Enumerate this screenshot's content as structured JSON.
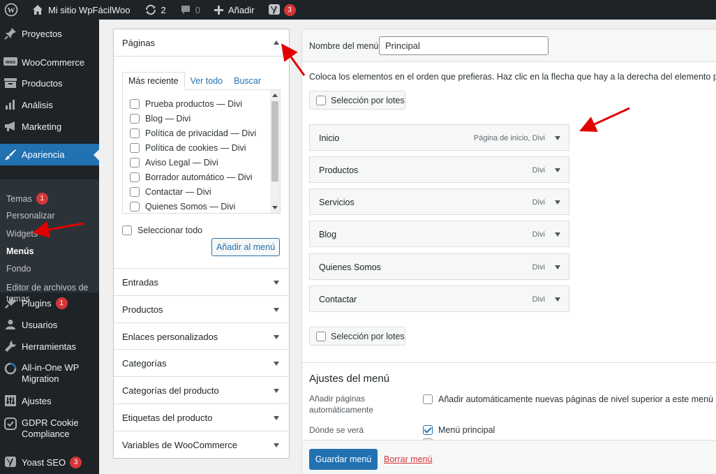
{
  "colors": {
    "adminbar_bg": "#1d2327",
    "accent": "#2271b1",
    "badge": "#d63638",
    "annotation_arrow": "#e00000"
  },
  "adminbar": {
    "wp_logo_icon": "wordpress-icon",
    "home_icon": "home-icon",
    "site_name": "Mi sitio WpFácilWoo",
    "updates_icon": "refresh-icon",
    "updates_count": "2",
    "comments_icon": "comment-icon",
    "comments_count": "0",
    "new_icon": "plus-icon",
    "new_label": "Añadir",
    "yoast_icon": "yoast-icon",
    "yoast_badge": "3"
  },
  "sidebar": {
    "items": [
      {
        "label": "Proyectos",
        "icon": "pin-icon"
      },
      {
        "label": "WooCommerce",
        "icon": "woo-icon"
      },
      {
        "label": "Productos",
        "icon": "archive-icon"
      },
      {
        "label": "Análisis",
        "icon": "chart-bars-icon"
      },
      {
        "label": "Marketing",
        "icon": "megaphone-icon"
      },
      {
        "label": "Apariencia",
        "icon": "brush-icon"
      },
      {
        "label": "Plugins",
        "icon": "plug-icon",
        "badge": "1"
      },
      {
        "label": "Usuarios",
        "icon": "user-icon"
      },
      {
        "label": "Herramientas",
        "icon": "wrench-icon"
      },
      {
        "label": "All-in-One WP Migration",
        "icon": "migration-icon"
      },
      {
        "label": "Ajustes",
        "icon": "sliders-icon"
      },
      {
        "label": "GDPR Cookie Compliance",
        "icon": "check-shield-icon"
      },
      {
        "label": "Yoast SEO",
        "icon": "yoast-icon",
        "badge": "3"
      }
    ],
    "submenu": [
      {
        "label": "Temas",
        "badge": "1"
      },
      {
        "label": "Personalizar"
      },
      {
        "label": "Widgets"
      },
      {
        "label": "Menús"
      },
      {
        "label": "Fondo"
      },
      {
        "label": "Editor de archivos de temas"
      }
    ]
  },
  "left_panel": {
    "title": "Páginas",
    "tabs": [
      "Más reciente",
      "Ver todo",
      "Buscar"
    ],
    "pages": [
      {
        "name": "Prueba productos",
        "builder": "Divi"
      },
      {
        "name": "Blog",
        "builder": "Divi"
      },
      {
        "name": "Política de privacidad",
        "builder": "Divi"
      },
      {
        "name": "Política de cookies",
        "builder": "Divi"
      },
      {
        "name": "Aviso Legal",
        "builder": "Divi"
      },
      {
        "name": "Borrador automático",
        "builder": "Divi"
      },
      {
        "name": "Contactar",
        "builder": "Divi"
      },
      {
        "name": "Quienes Somos",
        "builder": "Divi"
      }
    ],
    "separator": "—",
    "select_all": "Seleccionar todo",
    "add_button": "Añadir al menú",
    "accordions": [
      "Entradas",
      "Productos",
      "Enlaces personalizados",
      "Categorías",
      "Categorías del producto",
      "Etiquetas del producto",
      "Variables de WooCommerce"
    ]
  },
  "right_panel": {
    "name_label": "Nombre del menú",
    "name_value": "Principal",
    "instructions": "Coloca los elementos en el orden que prefieras. Haz clic en la flecha que hay a la derecha del elemento para most",
    "batch_label": "Selección por lotes",
    "menu_items": [
      {
        "title": "Inicio",
        "type": "Página de inicio, Divi"
      },
      {
        "title": "Productos",
        "type": "Divi"
      },
      {
        "title": "Servicios",
        "type": "Divi"
      },
      {
        "title": "Blog",
        "type": "Divi"
      },
      {
        "title": "Quienes Somos",
        "type": "Divi"
      },
      {
        "title": "Contactar",
        "type": "Divi"
      }
    ],
    "settings_title": "Ajustes del menú",
    "auto_add_label": "Añadir páginas automáticamente",
    "auto_add_option": "Añadir automáticamente nuevas páginas de nivel superior a este menú",
    "location_label": "Dónde se verá",
    "location_option": "Menú principal",
    "save_button": "Guardar menú",
    "delete_link": "Borrar menú"
  }
}
